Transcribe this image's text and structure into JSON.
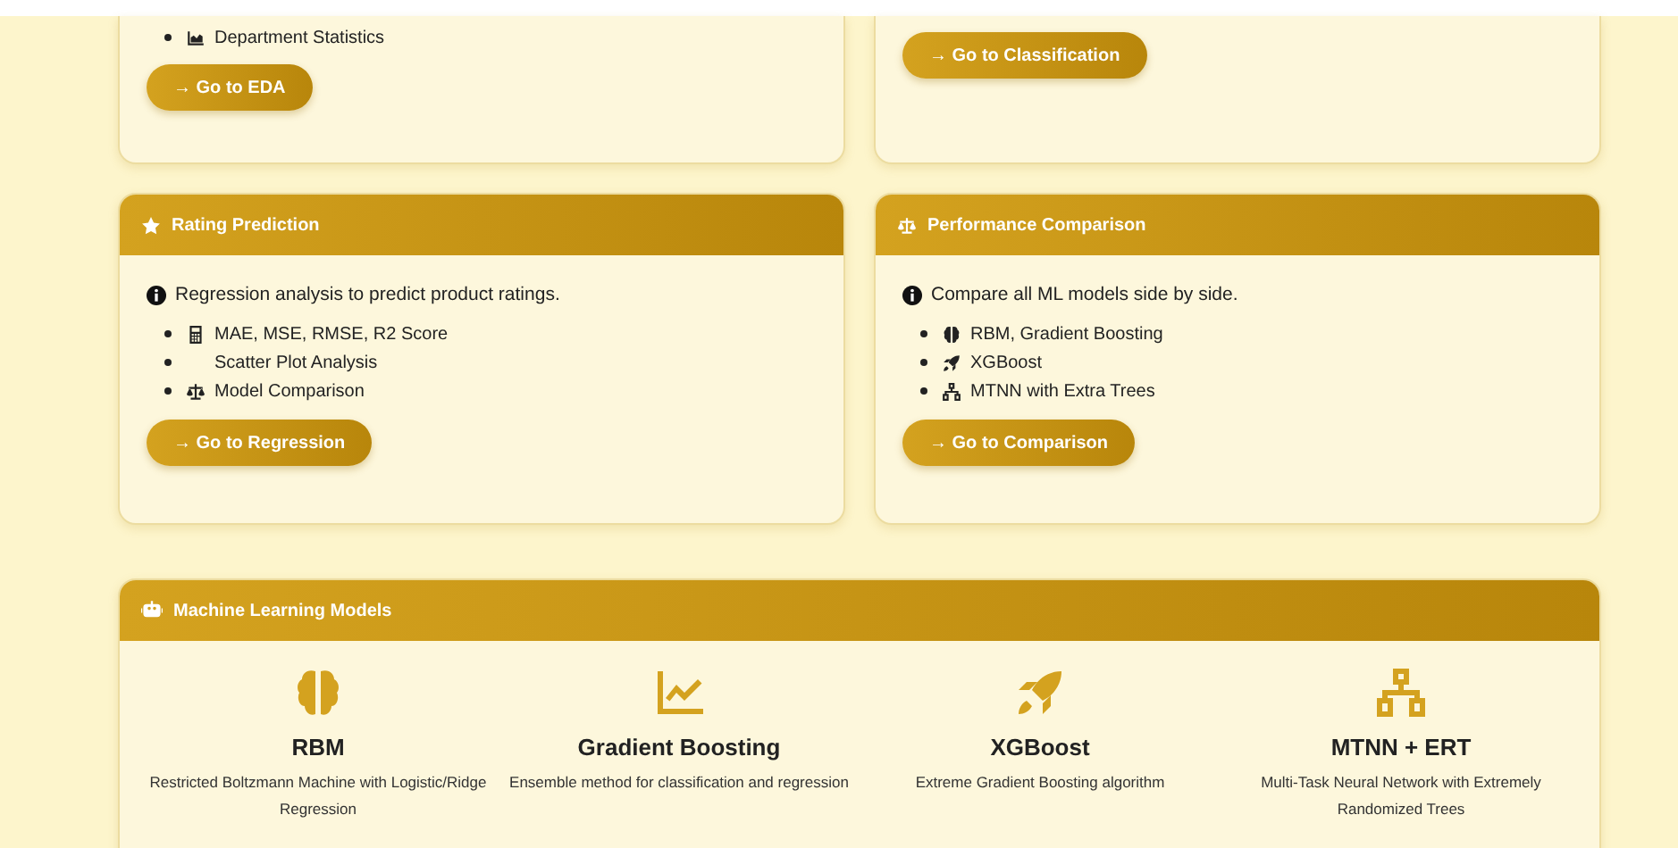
{
  "top_cards": [
    {
      "items": [
        {
          "text": "Department Statistics"
        }
      ],
      "button": "→ Go to EDA"
    },
    {
      "button": "→ Go to Classification"
    }
  ],
  "cards": [
    {
      "title": "Rating Prediction",
      "intro": "Regression analysis to predict product ratings.",
      "items": [
        {
          "text": "MAE, MSE, RMSE, R2 Score"
        },
        {
          "text": "Scatter Plot Analysis"
        },
        {
          "text": "Model Comparison"
        }
      ],
      "button": "→ Go to Regression"
    },
    {
      "title": "Performance Comparison",
      "intro": "Compare all ML models side by side.",
      "items": [
        {
          "text": "RBM, Gradient Boosting"
        },
        {
          "text": "XGBoost"
        },
        {
          "text": "MTNN with Extra Trees"
        }
      ],
      "button": "→ Go to Comparison"
    }
  ],
  "models_panel": {
    "title": "Machine Learning Models",
    "models": [
      {
        "name": "RBM",
        "description": "Restricted Boltzmann Machine with Logistic/Ridge Regression"
      },
      {
        "name": "Gradient Boosting",
        "description": "Ensemble method for classification and regression"
      },
      {
        "name": "XGBoost",
        "description": "Extreme Gradient Boosting algorithm"
      },
      {
        "name": "MTNN + ERT",
        "description": "Multi-Task Neural Network with Extremely Randomized Trees"
      }
    ]
  }
}
